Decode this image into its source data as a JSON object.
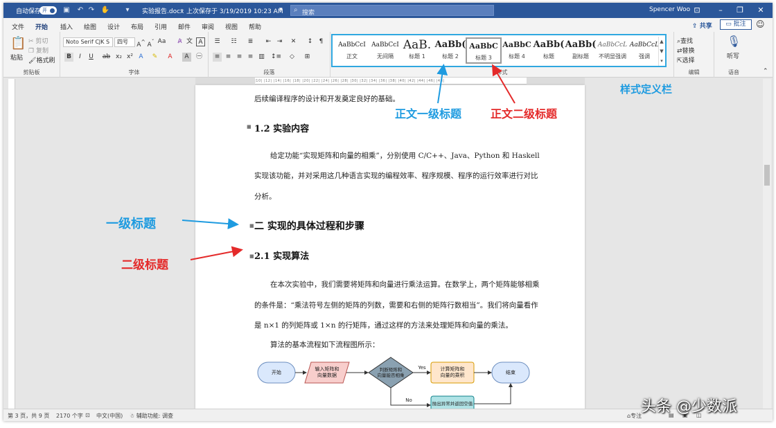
{
  "titlebar": {
    "autosave_label": "自动保存",
    "autosave_state": "开",
    "filename": "实验报告.docx",
    "save_status": "上次保存于 3/19/2019 10:23 AM",
    "search_placeholder": "搜索",
    "user": "Spencer Woo"
  },
  "menu": {
    "tabs": [
      "文件",
      "开始",
      "插入",
      "绘图",
      "设计",
      "布局",
      "引用",
      "邮件",
      "审阅",
      "视图",
      "帮助"
    ],
    "active": "开始",
    "share": "共享",
    "comment": "批注"
  },
  "ribbon": {
    "clipboard": {
      "paste": "粘贴",
      "cut": "剪切",
      "copy": "复制",
      "format_painter": "格式刷",
      "label": "剪贴板"
    },
    "font": {
      "name": "Noto Serif CJK S",
      "size": "四号",
      "label": "字体"
    },
    "paragraph": {
      "label": "段落"
    },
    "styles": {
      "label": "样式",
      "items": [
        {
          "preview": "AaBbCcI",
          "name": "正文"
        },
        {
          "preview": "AaBbCcI",
          "name": "无间隔"
        },
        {
          "preview": "AaB.",
          "name": "标题 1"
        },
        {
          "preview": "AaBb(",
          "name": "标题 2"
        },
        {
          "preview": "AaBbC",
          "name": "标题 3"
        },
        {
          "preview": "AaBbC",
          "name": "标题 4"
        },
        {
          "preview": "AaBb(",
          "name": "标题"
        },
        {
          "preview": "AaBb(",
          "name": "副标题"
        },
        {
          "preview": "AaBbCcL",
          "name": "不明显强调"
        },
        {
          "preview": "AaBbCcL",
          "name": "强调"
        }
      ],
      "selected_index": 4
    },
    "editing": {
      "find": "查找",
      "replace": "替换",
      "select": "选择",
      "label": "编辑"
    },
    "voice": {
      "dictate": "听写",
      "label": "语音"
    }
  },
  "document": {
    "line0": "后续编译程序的设计和开发奠定良好的基础。",
    "h_1_2": "1.2  实验内容",
    "para1": [
      "给定功能“实现矩阵和向量的相乘”，分别使用 C/C++、Java、Python 和 Haskell",
      "实现该功能，并对采用这几种语言实现的编程效率、程序规模、程序的运行效率进行对比",
      "分析。"
    ],
    "h_2": "二  实现的具体过程和步骤",
    "h_2_1": "2.1  实现算法",
    "para2": [
      "在本次实验中，我们需要将矩阵和向量进行乘法运算。在数学上，两个矩阵能够相乘",
      "的条件是：“乘法符号左侧的矩阵的列数，需要和右侧的矩阵行数相当”。我们将向量看作",
      "是 n×1 的列矩阵或 1×n 的行矩阵，通过这样的方法来处理矩阵和向量的乘法。"
    ],
    "para3": "算法的基本流程如下流程图所示：",
    "flow": {
      "start": "开始",
      "input": [
        "输入矩阵和",
        "向量数据"
      ],
      "decision": [
        "判断矩阵和",
        "向量能否相乘"
      ],
      "yes": "Yes",
      "no": "No",
      "compute": [
        "计算矩阵和",
        "向量的乘积"
      ],
      "end": "结束",
      "error": "抛出异常并返回空值"
    }
  },
  "annotations": {
    "style_bar": "样式定义栏",
    "body_h1": "正文一级标题",
    "body_h2": "正文二级标题",
    "h1": "一级标题",
    "h2": "二级标题"
  },
  "statusbar": {
    "page": "第 3 页，共 9 页",
    "words": "2170 个字",
    "language": "中文(中国)",
    "accessibility": "辅助功能: 调查",
    "focus": "专注"
  },
  "watermark": "头条 @少数派",
  "colors": {
    "title_blue": "#2b579a",
    "annot_blue": "#1e9be0",
    "annot_red": "#e42a2a"
  }
}
